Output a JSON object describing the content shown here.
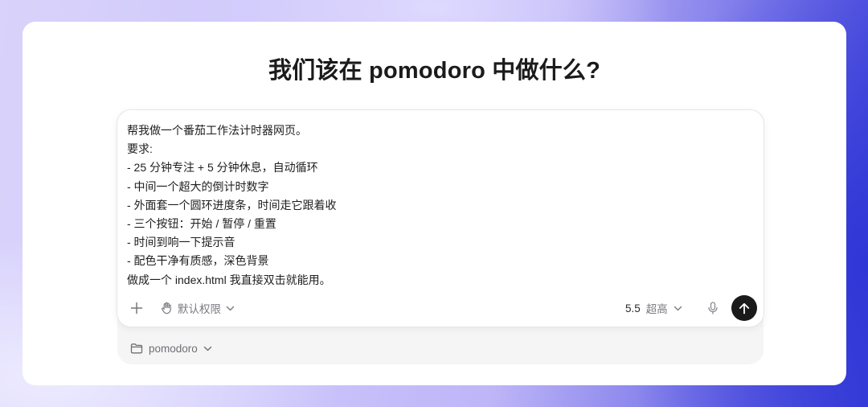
{
  "page": {
    "title": "我们该在 pomodoro 中做什么?"
  },
  "composer": {
    "prompt_text": "帮我做一个番茄工作法计时器网页。\n要求:\n- 25 分钟专注 + 5 分钟休息，自动循环\n- 中间一个超大的倒计时数字\n- 外面套一个圆环进度条，时间走它跟着收\n- 三个按钮：开始 / 暂停 / 重置\n- 时间到响一下提示音\n- 配色干净有质感，深色背景\n做成一个 index.html 我直接双击就能用。",
    "permission_label": "默认权限",
    "model_version": "5.5",
    "reasoning_level": "超高"
  },
  "project": {
    "name": "pomodoro"
  },
  "icons": {
    "add": "plus-icon",
    "permission": "hand-icon",
    "dropdown": "chevron-down-icon",
    "microphone": "microphone-icon",
    "send": "arrow-up-icon",
    "folder": "folder-icon"
  },
  "colors": {
    "send_button": "#1a1a1a",
    "muted_text": "#7a7a80"
  }
}
